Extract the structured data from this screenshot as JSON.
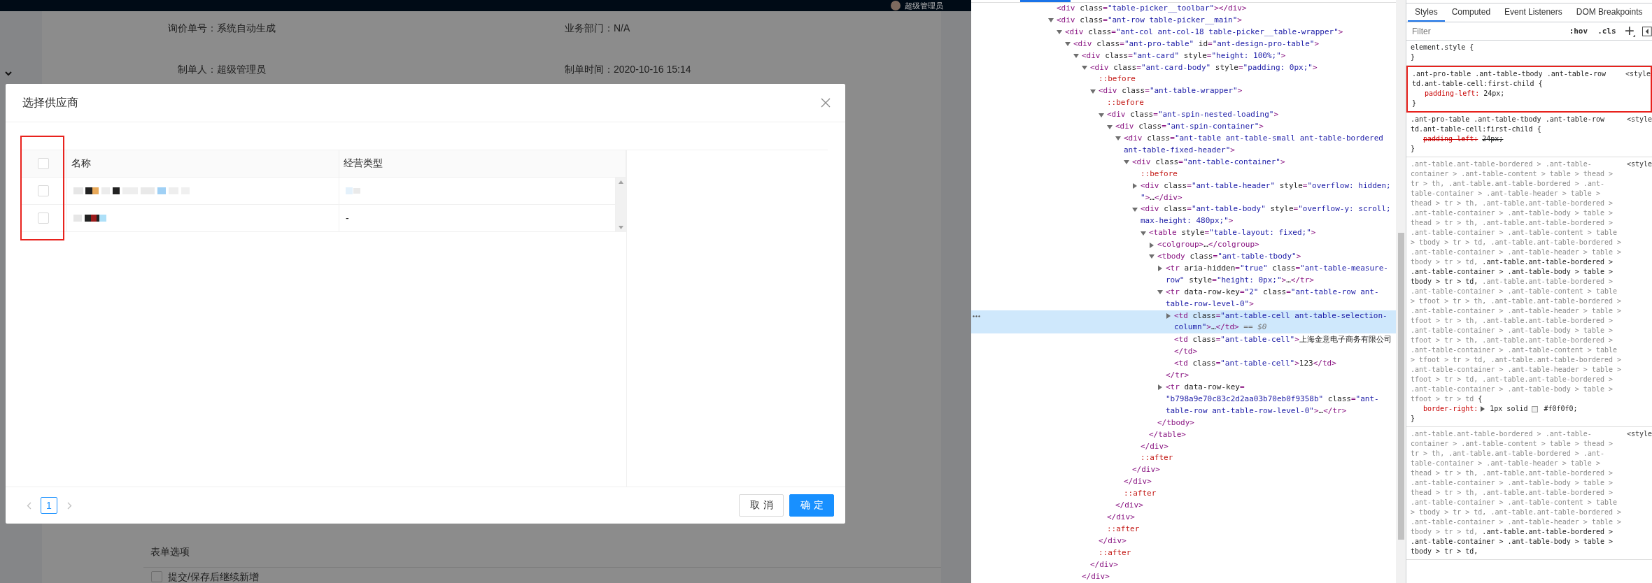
{
  "app_header": {
    "user": "超级管理员"
  },
  "form": {
    "fields": [
      {
        "label": "询价单号：",
        "value": "系统自动生成"
      },
      {
        "label": "业务部门：",
        "value": "N/A"
      },
      {
        "label": "制单人：",
        "value": "超级管理员"
      },
      {
        "label": "制单时间：",
        "value": "2020-10-16 15:14"
      }
    ],
    "section_title": "表单选项",
    "options": [
      {
        "label": "提交/保存后继续新增",
        "checked": false
      }
    ]
  },
  "modal": {
    "title": "选择供应商",
    "table": {
      "highlighted": true,
      "select_all": {
        "checked": false
      },
      "columns": [
        "名称",
        "经营类型"
      ],
      "rows": [
        {
          "checked": false
        },
        {
          "checked": false,
          "type": "-"
        }
      ]
    },
    "pagination": {
      "prev_disabled": true,
      "next_disabled": true,
      "pages": [
        {
          "label": "1",
          "selected": true
        }
      ]
    },
    "buttons": [
      {
        "label": "取消",
        "kind": "default"
      },
      {
        "label": "确定",
        "kind": "primary"
      }
    ]
  },
  "devtools": {
    "elements": {
      "nodes": [
        {
          "kind": "element",
          "open": "<div class=\"table-picker__toolbar\"></div>",
          "selected": false
        },
        {
          "kind": "element",
          "open": "<div class=\"ant-row table-picker__main\">",
          "expanded": true,
          "selected": false,
          "children": [
            {
              "kind": "element",
              "open": "<div class=\"ant-col ant-col-18 table-picker__table-wrapper\">",
              "expanded": true,
              "selected": false,
              "children": [
                {
                  "kind": "element",
                  "open": "<div class=\"ant-pro-table\" id=\"ant-design-pro-table\">",
                  "expanded": true,
                  "selected": false,
                  "children": [
                    {
                      "kind": "element",
                      "open": "<div class=\"ant-card\" style=\"height: 100%;\">",
                      "expanded": true,
                      "selected": false,
                      "close": "</div>",
                      "children": [
                        {
                          "kind": "element",
                          "open": "<div class=\"ant-card-body\" style=\"padding: 0px;\">",
                          "expanded": true,
                          "selected": false,
                          "close": "</div>",
                          "children": [
                            {
                              "kind": "pseudo",
                              "open": "::before",
                              "selected": false
                            },
                            {
                              "kind": "element",
                              "open": "<div class=\"ant-table-wrapper\">",
                              "expanded": true,
                              "selected": false,
                              "close": "</div>",
                              "children": [
                                {
                                  "kind": "pseudo",
                                  "open": "::before",
                                  "selected": false
                                },
                                {
                                  "kind": "element",
                                  "open": "<div class=\"ant-spin-nested-loading\">",
                                  "expanded": true,
                                  "selected": false,
                                  "close": "</div>",
                                  "children": [
                                    {
                                      "kind": "element",
                                      "open": "<div class=\"ant-spin-container\">",
                                      "expanded": true,
                                      "selected": false,
                                      "close": "</div>",
                                      "children": [
                                        {
                                          "kind": "element",
                                          "open": "<div class=\"ant-table ant-table-small ant-table-bordered ant-table-fixed-header\">",
                                          "expanded": true,
                                          "selected": false,
                                          "close": "</div>",
                                          "children": [
                                            {
                                              "kind": "element",
                                              "open": "<div class=\"ant-table-container\">",
                                              "expanded": true,
                                              "selected": false,
                                              "close": "</div>",
                                              "children": [
                                                {
                                                  "kind": "pseudo",
                                                  "open": "::before",
                                                  "selected": false
                                                },
                                                {
                                                  "kind": "element",
                                                  "open": "<div class=\"ant-table-header\" style=\"overflow: hidden; \">…</div>",
                                                  "expanded": false,
                                                  "selected": false
                                                },
                                                {
                                                  "kind": "element",
                                                  "open": "<div class=\"ant-table-body\" style=\"overflow-y: scroll; max-height: 480px;\">",
                                                  "expanded": true,
                                                  "selected": false,
                                                  "close": "</div>",
                                                  "children": [
                                                    {
                                                      "kind": "element",
                                                      "open": "<table style=\"table-layout: fixed;\">",
                                                      "expanded": true,
                                                      "selected": false,
                                                      "close": "</table>",
                                                      "children": [
                                                        {
                                                          "kind": "element",
                                                          "open": "<colgroup>…</colgroup>",
                                                          "expanded": false,
                                                          "selected": false
                                                        },
                                                        {
                                                          "kind": "element",
                                                          "open": "<tbody class=\"ant-table-tbody\">",
                                                          "expanded": true,
                                                          "selected": false,
                                                          "close": "</tbody>",
                                                          "children": [
                                                            {
                                                              "kind": "element",
                                                              "open": "<tr aria-hidden=\"true\" class=\"ant-table-measure-row\" style=\"height: 0px;\">…</tr>",
                                                              "expanded": false,
                                                              "selected": false
                                                            },
                                                            {
                                                              "kind": "element",
                                                              "open": "<tr data-row-key=\"2\" class=\"ant-table-row ant-table-row-level-0\">",
                                                              "expanded": true,
                                                              "selected": false,
                                                              "close": "</tr>",
                                                              "children": [
                                                                {
                                                                  "kind": "element",
                                                                  "open": "<td class=\"ant-table-cell ant-table-selection-column\">…</td>",
                                                                  "expanded": false,
                                                                  "selected": true,
                                                                  "ref": "== $0"
                                                                },
                                                                {
                                                                  "kind": "element",
                                                                  "open": "<td class=\"ant-table-cell\">",
                                                                  "content": "上海金意电子商务有限公司",
                                                                  "end": "</td>",
                                                                  "selected": false
                                                                },
                                                                {
                                                                  "kind": "element",
                                                                  "open": "<td class=\"ant-table-cell\">123</td>",
                                                                  "selected": false
                                                                }
                                                              ]
                                                            },
                                                            {
                                                              "kind": "element",
                                                              "open": "<tr data-row-key=\"b798a9e70c83c2d2aa03b70eb0f9358b\" class=\"ant-table-row ant-table-row-level-0\">…</tr>",
                                                              "expanded": false,
                                                              "selected": false
                                                            }
                                                          ]
                                                        }
                                                      ]
                                                    }
                                                  ]
                                                },
                                                {
                                                  "kind": "pseudo",
                                                  "open": "::after",
                                                  "selected": false
                                                }
                                              ]
                                            }
                                          ]
                                        },
                                        {
                                          "kind": "pseudo",
                                          "open": "::after",
                                          "selected": false
                                        }
                                      ]
                                    }
                                  ]
                                },
                                {
                                  "kind": "pseudo",
                                  "open": "::after",
                                  "selected": false
                                }
                              ]
                            },
                            {
                              "kind": "pseudo",
                              "open": "::after",
                              "selected": false
                            }
                          ]
                        }
                      ]
                    }
                  ]
                }
              ]
            }
          ]
        }
      ]
    },
    "styles": {
      "tabs": [
        {
          "label": "Styles",
          "selected": true
        },
        {
          "label": "Computed",
          "selected": false
        },
        {
          "label": "Event Listeners",
          "selected": false
        },
        {
          "label": "DOM Breakpoints",
          "selected": false
        }
      ],
      "filter": {
        "placeholder": "Filter"
      },
      "tools": [
        ":hov",
        ".cls"
      ],
      "rules": [
        {
          "selectors": [
            {
              "text": "element.style",
              "matched": true
            }
          ],
          "open": "{",
          "close": "}",
          "highlighted": false
        },
        {
          "selectors": [
            {
              "text": ".ant-pro-table .ant-table-tbody .ant-table-row td.ant-table-cell:first-child",
              "matched": true
            }
          ],
          "open": "{",
          "declarations": [
            {
              "property": "padding-left:",
              "value": "24px;",
              "overridden": false
            }
          ],
          "close": "}",
          "source": "<style",
          "highlighted": true
        },
        {
          "selectors": [
            {
              "text": ".ant-pro-table .ant-table-tbody .ant-table-row td.ant-table-cell:first-child",
              "matched": true
            }
          ],
          "open": "{",
          "declarations": [
            {
              "property": "padding-left:",
              "value": "24px;",
              "overridden": true
            }
          ],
          "close": "}",
          "source": "<style",
          "highlighted": false
        },
        {
          "selectors": [
            {
              "text": ".ant-table.ant-table-bordered > .ant-table-container > .ant-table-content > table > thead > tr > th,",
              "matched": false
            },
            {
              "text": ".ant-table.ant-table-bordered > .ant-table-container > .ant-table-header > table > thead > tr > th,",
              "matched": false
            },
            {
              "text": ".ant-table.ant-table-bordered > .ant-table-container > .ant-table-body > table > thead > tr > th,",
              "matched": false
            },
            {
              "text": ".ant-table.ant-table-bordered > .ant-table-container > .ant-table-content > table > tbody > tr > td,",
              "matched": false
            },
            {
              "text": ".ant-table.ant-table-bordered > .ant-table-container > .ant-table-header > table > tbody > tr > td,",
              "matched": false
            },
            {
              "text": ".ant-table.ant-table-bordered > .ant-table-container > .ant-table-body > table > tbody > tr > td,",
              "matched": true
            },
            {
              "text": ".ant-table.ant-table-bordered > .ant-table-container > .ant-table-content > table > tfoot > tr > th,",
              "matched": false
            },
            {
              "text": ".ant-table.ant-table-bordered > .ant-table-container > .ant-table-header > table > tfoot > tr > th,",
              "matched": false
            },
            {
              "text": ".ant-table.ant-table-bordered > .ant-table-container > .ant-table-body > table > tfoot > tr > th,",
              "matched": false
            },
            {
              "text": ".ant-table.ant-table-bordered > .ant-table-container > .ant-table-content > table > tfoot > tr > td,",
              "matched": false
            },
            {
              "text": ".ant-table.ant-table-bordered > .ant-table-container > .ant-table-header > table > tfoot > tr > td,",
              "matched": false
            },
            {
              "text": ".ant-table.ant-table-bordered > .ant-table-container > .ant-table-body > table > tfoot > tr > td",
              "matched": false
            }
          ],
          "open": "{",
          "declarations": [
            {
              "property": "border-right:",
              "value": "1px solid",
              "color": "#f0f0f0",
              "value_end": "#f0f0f0;",
              "overridden": false
            }
          ],
          "close": "}",
          "source": "<style",
          "highlighted": false
        },
        {
          "selectors": [
            {
              "text": ".ant-table.ant-table-bordered > .ant-table-container > .ant-table-content > table > thead > tr > th,",
              "matched": false
            },
            {
              "text": ".ant-table.ant-table-bordered > .ant-table-container > .ant-table-header > table > thead > tr > th,",
              "matched": false
            },
            {
              "text": ".ant-table.ant-table-bordered > .ant-table-container > .ant-table-body > table > thead > tr > th,",
              "matched": false
            },
            {
              "text": ".ant-table.ant-table-bordered > .ant-table-container > .ant-table-content > table > tbody > tr > td,",
              "matched": false
            },
            {
              "text": ".ant-table.ant-table-bordered > .ant-table-container > .ant-table-header > table > tbody > tr > td,",
              "matched": false
            },
            {
              "text": ".ant-table.ant-table-bordered > .ant-table-container > .ant-table-body > table > tbody > tr > td,",
              "matched": true
            }
          ],
          "source": "<style",
          "highlighted": false
        }
      ]
    }
  }
}
